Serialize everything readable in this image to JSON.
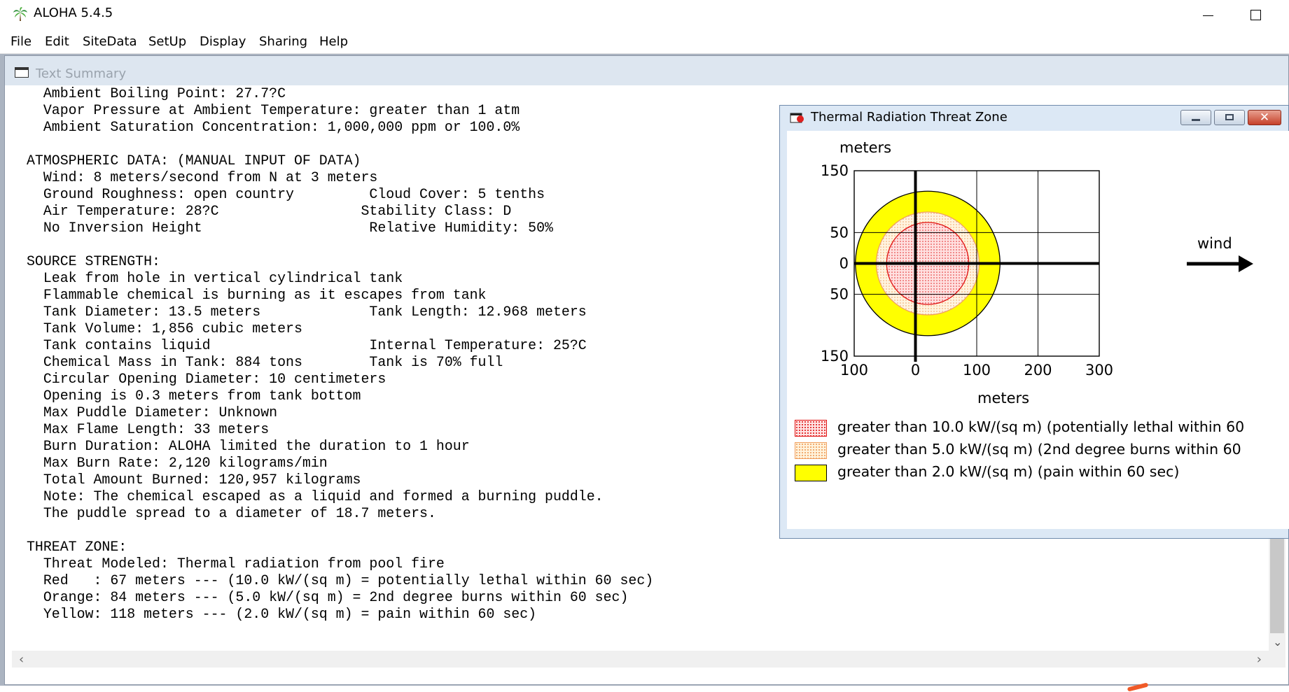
{
  "app": {
    "title": "ALOHA 5.4.5"
  },
  "menu": [
    "File",
    "Edit",
    "SiteData",
    "SetUp",
    "Display",
    "Sharing",
    "Help"
  ],
  "text_summary": {
    "title": "Text Summary",
    "lines": [
      "Ambient Boiling Point: 27.7?C",
      "Vapor Pressure at Ambient Temperature: greater than 1 atm",
      "Ambient Saturation Concentration: 1,000,000 ppm or 100.0%",
      "",
      "ATMOSPHERIC DATA: (MANUAL INPUT OF DATA)",
      "Wind: 8 meters/second from N at 3 meters",
      "Ground Roughness: open country         Cloud Cover: 5 tenths",
      "Air Temperature: 28?C                 Stability Class: D",
      "No Inversion Height                    Relative Humidity: 50%",
      "",
      "SOURCE STRENGTH:",
      "Leak from hole in vertical cylindrical tank",
      "Flammable chemical is burning as it escapes from tank",
      "Tank Diameter: 13.5 meters             Tank Length: 12.968 meters",
      "Tank Volume: 1,856 cubic meters",
      "Tank contains liquid                   Internal Temperature: 25?C",
      "Chemical Mass in Tank: 884 tons        Tank is 70% full",
      "Circular Opening Diameter: 10 centimeters",
      "Opening is 0.3 meters from tank bottom",
      "Max Puddle Diameter: Unknown",
      "Max Flame Length: 33 meters",
      "Burn Duration: ALOHA limited the duration to 1 hour",
      "Max Burn Rate: 2,120 kilograms/min",
      "Total Amount Burned: 120,957 kilograms",
      "Note: The chemical escaped as a liquid and formed a burning puddle.",
      "The puddle spread to a diameter of 18.7 meters.",
      "",
      "THREAT ZONE:",
      "Threat Modeled: Thermal radiation from pool fire",
      "Red   : 67 meters --- (10.0 kW/(sq m) = potentially lethal within 60 sec)",
      "Orange: 84 meters --- (5.0 kW/(sq m) = 2nd degree burns within 60 sec)",
      "Yellow: 118 meters --- (2.0 kW/(sq m) = pain within 60 sec)"
    ]
  },
  "threat_window": {
    "title": "Thermal Radiation Threat Zone",
    "close_symbol": "✕",
    "wind_label": "wind",
    "legend": [
      {
        "text": "greater than 10.0 kW/(sq m) (potentially lethal within 60",
        "color": "#e01010"
      },
      {
        "text": "greater than 5.0 kW/(sq m) (2nd degree burns within 60",
        "color": "#f0a060"
      },
      {
        "text": "greater than 2.0 kW/(sq m) (pain within 60 sec)",
        "color": "#ffff00"
      }
    ]
  },
  "chart_data": {
    "type": "threat-zone-plot",
    "xlabel": "meters",
    "ylabel": "meters",
    "x_tick_labels": [
      "100",
      "0",
      "100",
      "200",
      "300"
    ],
    "x_tick_values": [
      -100,
      0,
      100,
      200,
      300
    ],
    "y_tick_labels": [
      "150",
      "50",
      "0",
      "50",
      "150"
    ],
    "y_tick_values": [
      150,
      50,
      0,
      -50,
      -150
    ],
    "xlim": [
      -100,
      300
    ],
    "ylim": [
      -150,
      150
    ],
    "grid": true,
    "wind_direction": "east",
    "zones": [
      {
        "name": "yellow",
        "radius": 118,
        "center_x": 20,
        "center_y": 0,
        "fill": "#ffff00",
        "stroke": "#000000"
      },
      {
        "name": "orange",
        "radius": 84,
        "center_x": 20,
        "center_y": 0,
        "fill": "#fff0d8",
        "stroke": "#f0a060"
      },
      {
        "name": "red",
        "radius": 67,
        "center_x": 20,
        "center_y": 0,
        "fill": "#ffdcdc",
        "stroke": "#e01010"
      }
    ]
  }
}
